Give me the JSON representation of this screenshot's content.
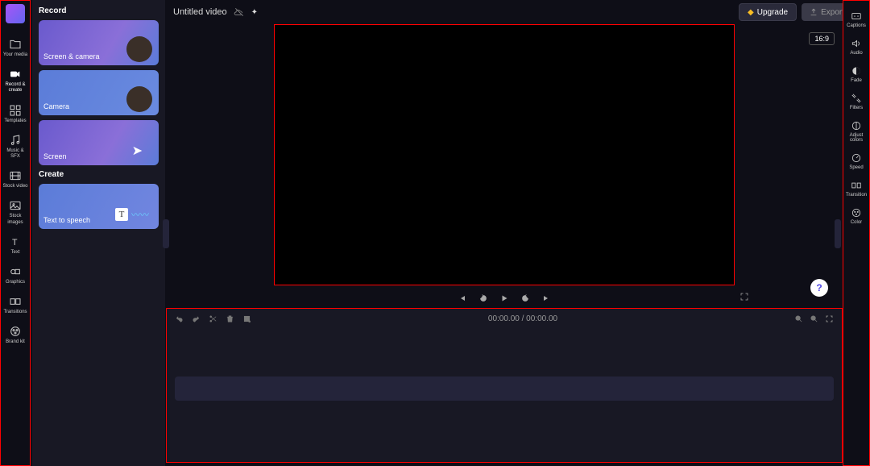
{
  "header": {
    "title": "Untitled video",
    "upgrade_label": "Upgrade",
    "export_label": "Export"
  },
  "left_rail": {
    "items": [
      {
        "label": "Your media",
        "icon": "folder-icon"
      },
      {
        "label": "Record & create",
        "icon": "camera-icon",
        "active": true
      },
      {
        "label": "Templates",
        "icon": "templates-icon"
      },
      {
        "label": "Music & SFX",
        "icon": "music-icon"
      },
      {
        "label": "Stock video",
        "icon": "stock-video-icon"
      },
      {
        "label": "Stock images",
        "icon": "stock-images-icon"
      },
      {
        "label": "Text",
        "icon": "text-icon"
      },
      {
        "label": "Graphics",
        "icon": "graphics-icon"
      },
      {
        "label": "Transitions",
        "icon": "transitions-icon"
      },
      {
        "label": "Brand kit",
        "icon": "brand-kit-icon"
      }
    ]
  },
  "panel": {
    "record_heading": "Record",
    "create_heading": "Create",
    "cards": [
      {
        "label": "Screen & camera"
      },
      {
        "label": "Camera"
      },
      {
        "label": "Screen"
      }
    ],
    "tts_label": "Text to speech"
  },
  "right_rail": {
    "items": [
      {
        "label": "Captions",
        "icon": "captions-icon"
      },
      {
        "label": "Audio",
        "icon": "audio-icon"
      },
      {
        "label": "Fade",
        "icon": "fade-icon"
      },
      {
        "label": "Filters",
        "icon": "filters-icon"
      },
      {
        "label": "Adjust colors",
        "icon": "adjust-colors-icon"
      },
      {
        "label": "Speed",
        "icon": "speed-icon"
      },
      {
        "label": "Transition",
        "icon": "transition-icon"
      },
      {
        "label": "Color",
        "icon": "color-icon"
      }
    ]
  },
  "preview": {
    "aspect_ratio": "16:9"
  },
  "timeline": {
    "time_current": "00:00.00",
    "time_separator": " / ",
    "time_total": "00:00.00"
  },
  "help": {
    "label": "?"
  }
}
